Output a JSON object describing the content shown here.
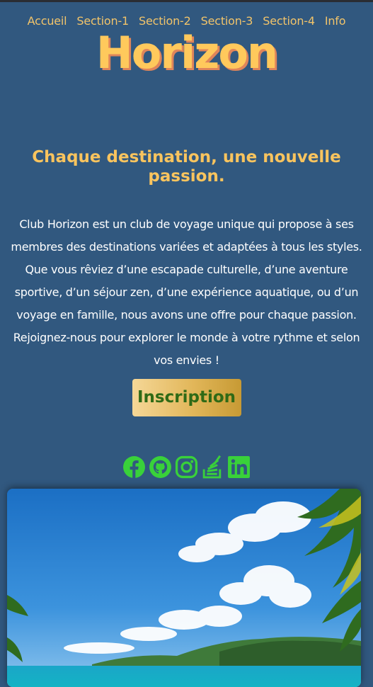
{
  "nav": {
    "items": [
      "Accueil",
      "Section-1",
      "Section-2",
      "Section-3",
      "Section-4",
      "Info"
    ]
  },
  "brand": "Horizon",
  "tagline": "Chaque destination, une nouvelle passion.",
  "intro": "Club Horizon est un club de voyage unique qui propose à ses membres des destinations variées et adaptées à tous les styles. Que vous rêviez d’une escapade culturelle, d’une aventure sportive, d’un séjour zen, d’une expérience aquatique, ou d’un voyage en famille, nous avons une offre pour chaque passion. Rejoignez-nous pour explorer le monde à votre rythme et selon vos envies !",
  "cta": "Inscription",
  "social": [
    "facebook-icon",
    "github-icon",
    "instagram-icon",
    "stackoverflow-icon",
    "linkedin-icon"
  ],
  "colors": {
    "background": "#31587f",
    "accent": "#ffc95c",
    "social": "#39d13a"
  }
}
